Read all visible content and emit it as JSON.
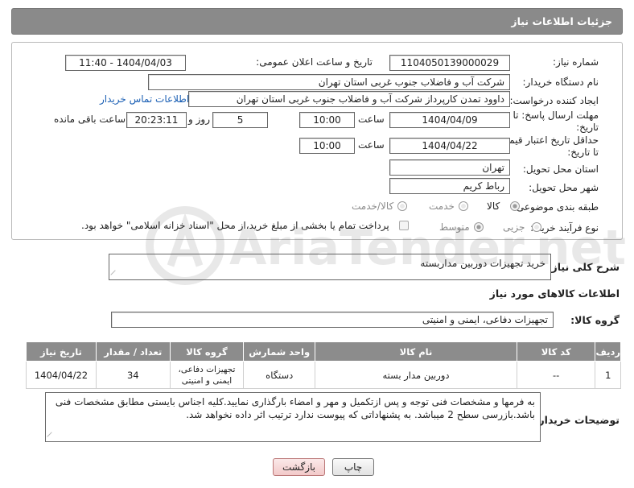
{
  "header": {
    "title": "جزئیات اطلاعات نیاز"
  },
  "form": {
    "need_number_label": "شماره نیاز:",
    "need_number": "1104050139000029",
    "announce_label": "تاریخ و ساعت اعلان عمومی:",
    "announce_value": "1404/04/03 - 11:40",
    "buyer_org_label": "نام دستگاه خریدار:",
    "buyer_org": "شرکت آب و فاضلاب جنوب غربی استان تهران",
    "creator_label": "ایجاد کننده درخواست:",
    "creator": "داوود  تمدن  کارپرداز شرکت آب و فاضلاب جنوب غربی استان تهران",
    "contact_link": "اطلاعات تماس خریدار",
    "reply_deadline_label": "مهلت ارسال پاسخ: تا تاریخ:",
    "reply_date": "1404/04/09",
    "time_label": "ساعت",
    "reply_time": "10:00",
    "days_value": "5",
    "days_label": "روز و",
    "remaining_time": "20:23:11",
    "remaining_label": "ساعت باقی مانده",
    "price_validity_label": "حداقل تاریخ اعتبار قیمت: تا تاریخ:",
    "price_date": "1404/04/22",
    "price_time": "10:00",
    "province_label": "استان محل تحویل:",
    "province": "تهران",
    "city_label": "شهر محل تحویل:",
    "city": "رباط کریم",
    "category_label": "طبقه بندی موضوعی:",
    "category_options": [
      "کالا",
      "خدمت",
      "کالا/خدمت"
    ],
    "process_label": "نوع فرآیند خرید :",
    "process_options": [
      "جزیی",
      "متوسط"
    ],
    "payment_note": "پرداخت تمام یا بخشی از مبلغ خرید،از محل \"اسناد خزانه اسلامی\" خواهد بود."
  },
  "summary": {
    "label": "شرح کلی نیاز:",
    "value": "خرید تجهیزات دوربین مداربسته"
  },
  "goods": {
    "section_title": "اطلاعات کالاهای مورد نیاز",
    "group_label": "گروه کالا:",
    "group_value": "تجهیزات دفاعی، ایمنی و امنیتی"
  },
  "table": {
    "headers": [
      "ردیف",
      "کد کالا",
      "نام کالا",
      "واحد شمارش",
      "گروه کالا",
      "تعداد / مقدار",
      "تاریخ نیاز"
    ],
    "rows": [
      [
        "1",
        "--",
        "دوربین مدار بسته",
        "دستگاه",
        "تجهیزات دفاعی، ایمنی و امنیتی",
        "34",
        "1404/04/22"
      ]
    ]
  },
  "buyer_notes": {
    "label": "توضیحات خریدار:",
    "value": "به فرمها و مشخصات فنی توجه و پس ازتکمیل و مهر و امضاء بارگذاری نمایید.کلیه اجناس بایستی مطابق مشخصات فنی باشد.بازرسی سطح 2 میباشد. به پشنهاداتی که پیوست ندارد ترتیب اثر داده نخواهد شد."
  },
  "buttons": {
    "print": "چاپ",
    "back": "بازگشت"
  },
  "watermark": {
    "text": "AriaTender.net"
  },
  "colors": {
    "header_bg": "#8a8a8a",
    "link": "#1a5fb4",
    "back_btn": "#f2c9c9"
  }
}
